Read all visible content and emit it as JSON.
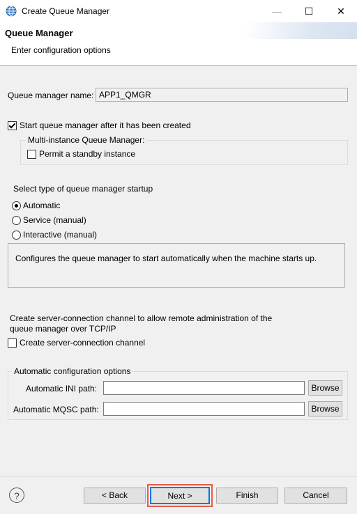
{
  "window": {
    "title": "Create Queue Manager",
    "minimize": "—",
    "maximize": "☐",
    "close": "✕"
  },
  "banner": {
    "heading": "Queue Manager",
    "subtitle": "Enter configuration options"
  },
  "qm_name": {
    "label": "Queue manager name:",
    "value": "APP1_QMGR"
  },
  "start_after_create": {
    "label": "Start queue manager after it has been created",
    "checked": true
  },
  "multi_instance": {
    "group_title": "Multi-instance Queue Manager:",
    "standby_label": "Permit a standby instance",
    "standby_checked": false
  },
  "startup": {
    "heading": "Select type of queue manager startup",
    "options": [
      {
        "label": "Automatic",
        "selected": true
      },
      {
        "label": "Service (manual)",
        "selected": false
      },
      {
        "label": "Interactive (manual)",
        "selected": false
      }
    ],
    "description": "Configures the queue manager to start automatically when the machine starts up."
  },
  "server_conn": {
    "text_line1": "Create server-connection channel to allow remote administration of the",
    "text_line2": "queue manager over TCP/IP",
    "checkbox_label": "Create server-connection channel",
    "checked": false
  },
  "auto_config": {
    "group_title": "Automatic configuration options",
    "ini_label": "Automatic INI path:",
    "ini_value": "",
    "mqsc_label": "Automatic MQSC path:",
    "mqsc_value": "",
    "browse_label": "Browse"
  },
  "footer": {
    "help": "?",
    "back": "< Back",
    "next": "Next >",
    "finish": "Finish",
    "cancel": "Cancel"
  }
}
